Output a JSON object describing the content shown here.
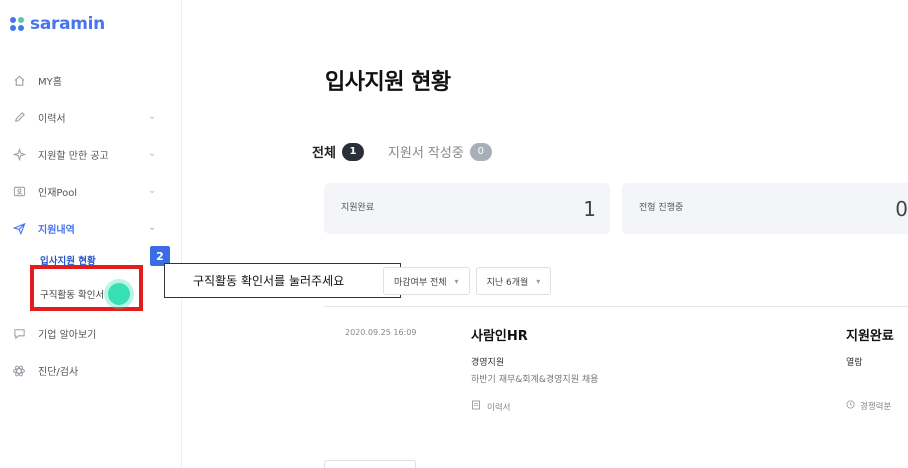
{
  "brand": {
    "name": "saramin",
    "dot_colors": [
      "#4876ef",
      "#5cc6a8",
      "#4876ef",
      "#4876ef"
    ]
  },
  "sidebar": {
    "items": [
      {
        "label": "MY홈",
        "icon": "home-icon"
      },
      {
        "label": "이력서",
        "icon": "pencil-icon",
        "chevron": "⌄"
      },
      {
        "label": "지원할 만한 공고",
        "icon": "sparkle-icon",
        "chevron": "⌄"
      },
      {
        "label": "인재Pool",
        "icon": "id-card-icon",
        "chevron": "⌄"
      },
      {
        "label": "지원내역",
        "icon": "send-icon",
        "chevron": "⌄",
        "active": true
      },
      {
        "label": "기업 알아보기",
        "icon": "chat-icon"
      },
      {
        "label": "진단/검사",
        "icon": "atom-icon"
      }
    ],
    "subitems": [
      {
        "label": "입사지원 현황",
        "current": true
      },
      {
        "label": "구직활동 확인서"
      }
    ]
  },
  "tutorial": {
    "step": "2",
    "tooltip": "구직활동 확인서를 눌러주세요"
  },
  "main": {
    "title": "입사지원 현황",
    "tabs": [
      {
        "label": "전체",
        "count": "1"
      },
      {
        "label": "지원서 작성중",
        "count": "0"
      }
    ],
    "stats": [
      {
        "label": "지원완료",
        "value": "1"
      },
      {
        "label": "전형 진행중",
        "value": "0"
      }
    ],
    "filters": [
      {
        "label": "마감여부 전체"
      },
      {
        "label": "지난 6개월"
      }
    ],
    "applications": [
      {
        "date": "2020.09.25 16:09",
        "company": "사람인HR",
        "field": "경영지원",
        "title": "하반기 재무&회계&경영지원 채용",
        "resume": "이력서",
        "status": "지원완료",
        "status_sub": "열람",
        "status_note": "경쟁력분"
      }
    ]
  }
}
